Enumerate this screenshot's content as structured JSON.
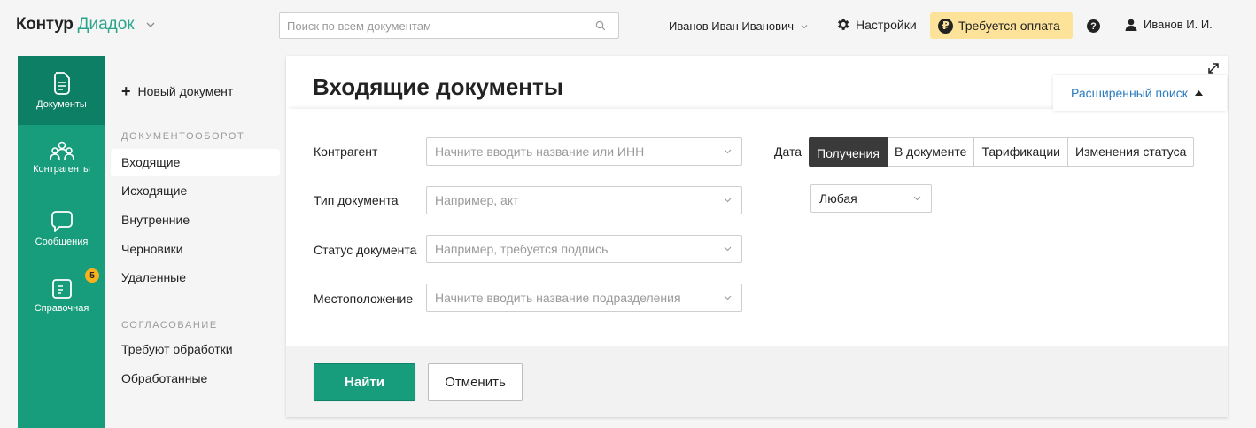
{
  "topbar": {
    "logo_brand": "Контур",
    "logo_product": "Диадок",
    "search_placeholder": "Поиск по всем документам",
    "user_name": "Иванов Иван Иванович",
    "settings_label": "Настройки",
    "payment_label": "Требуется оплата",
    "payment_icon": "ruble-icon",
    "help_glyph": "?",
    "account_label": "Иванов И. И."
  },
  "rail": {
    "items": [
      {
        "label": "Документы",
        "icon": "document-icon"
      },
      {
        "label": "Контрагенты",
        "icon": "people-icon"
      },
      {
        "label": "Сообщения",
        "icon": "chat-icon"
      },
      {
        "label": "Справочная",
        "icon": "book-icon"
      }
    ],
    "badge_count": "5"
  },
  "nav": {
    "new_document": "Новый документ",
    "section_workflow": "ДОКУМЕНТООБОРОТ",
    "workflow_items": [
      "Входящие",
      "Исходящие",
      "Внутренние",
      "Черновики",
      "Удаленные"
    ],
    "section_approval": "СОГЛАСОВАНИЕ",
    "approval_items": [
      "Требуют обработки",
      "Обработанные"
    ]
  },
  "main": {
    "title": "Входящие документы",
    "advanced_search": "Расширенный поиск",
    "filters": [
      {
        "label": "Контрагент",
        "placeholder": "Начните вводить название или ИНН"
      },
      {
        "label": "Тип документа",
        "placeholder": "Например, акт"
      },
      {
        "label": "Статус документа",
        "placeholder": "Например, требуется подпись"
      },
      {
        "label": "Местоположение",
        "placeholder": "Начните вводить название подразделения"
      }
    ],
    "date_label": "Дата",
    "date_tabs": [
      "Получения",
      "В документе",
      "Тарификации",
      "Изменения статуса"
    ],
    "date_range_value": "Любая",
    "find_button": "Найти",
    "cancel_button": "Отменить"
  },
  "colors": {
    "brand_green": "#179d7c",
    "brand_green_active": "#0d7f64",
    "link_blue": "#2a7bbf",
    "payment_yellow": "#fde39a",
    "badge_orange": "#f7b11d"
  }
}
